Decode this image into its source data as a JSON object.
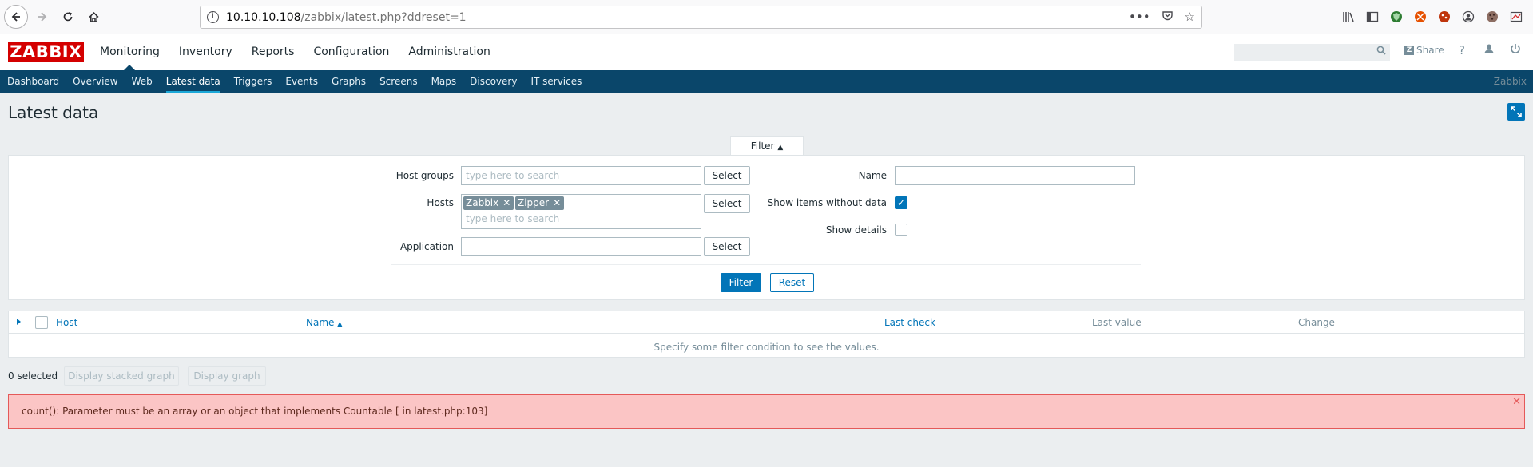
{
  "browser": {
    "url_host": "10.10.10.108",
    "url_path": "/zabbix/latest.php?ddreset=1"
  },
  "logo": "ZABBIX",
  "main_menu": [
    {
      "label": "Monitoring"
    },
    {
      "label": "Inventory"
    },
    {
      "label": "Reports"
    },
    {
      "label": "Configuration"
    },
    {
      "label": "Administration"
    }
  ],
  "header": {
    "share_label": "Share",
    "help_label": "?"
  },
  "sub_menu": [
    {
      "label": "Dashboard"
    },
    {
      "label": "Overview"
    },
    {
      "label": "Web"
    },
    {
      "label": "Latest data"
    },
    {
      "label": "Triggers"
    },
    {
      "label": "Events"
    },
    {
      "label": "Graphs"
    },
    {
      "label": "Screens"
    },
    {
      "label": "Maps"
    },
    {
      "label": "Discovery"
    },
    {
      "label": "IT services"
    }
  ],
  "sub_menu_brand": "Zabbix",
  "page_title": "Latest data",
  "filter": {
    "tab_label": "Filter",
    "host_groups_label": "Host groups",
    "hosts_label": "Hosts",
    "application_label": "Application",
    "name_label": "Name",
    "show_without_data_label": "Show items without data",
    "show_details_label": "Show details",
    "search_placeholder": "type here to search",
    "select_label": "Select",
    "host_chips": [
      "Zabbix",
      "Zipper"
    ],
    "filter_button": "Filter",
    "reset_button": "Reset"
  },
  "table": {
    "columns": {
      "host": "Host",
      "name": "Name",
      "last_check": "Last check",
      "last_value": "Last value",
      "change": "Change"
    },
    "empty_message": "Specify some filter condition to see the values."
  },
  "actions": {
    "selected_count": "0 selected",
    "stacked_graph": "Display stacked graph",
    "display_graph": "Display graph"
  },
  "error": {
    "message": "count(): Parameter must be an array or an object that implements Countable [ in latest.php:103]"
  },
  "colors": {
    "brand_red": "#d40000",
    "submenu_bg": "#0a466a",
    "accent_blue": "#0275b8",
    "error_bg": "#fbc5c5"
  }
}
